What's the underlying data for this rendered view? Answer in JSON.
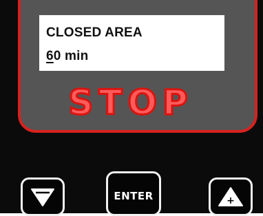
{
  "display": {
    "line1": "CLOSED AREA",
    "line2_cursor": "6",
    "line2_rest": "0 min"
  },
  "status": {
    "label": "STOP",
    "color": "#d9140f"
  },
  "buttons": {
    "down": {
      "icon": "triangle-down-icon"
    },
    "enter": {
      "label": "ENTER"
    },
    "up": {
      "icon": "triangle-up-plus-icon",
      "symbol": "+"
    }
  },
  "colors": {
    "bezel": "#555555",
    "accent": "#d8211f",
    "body": "#0b0b0b"
  }
}
